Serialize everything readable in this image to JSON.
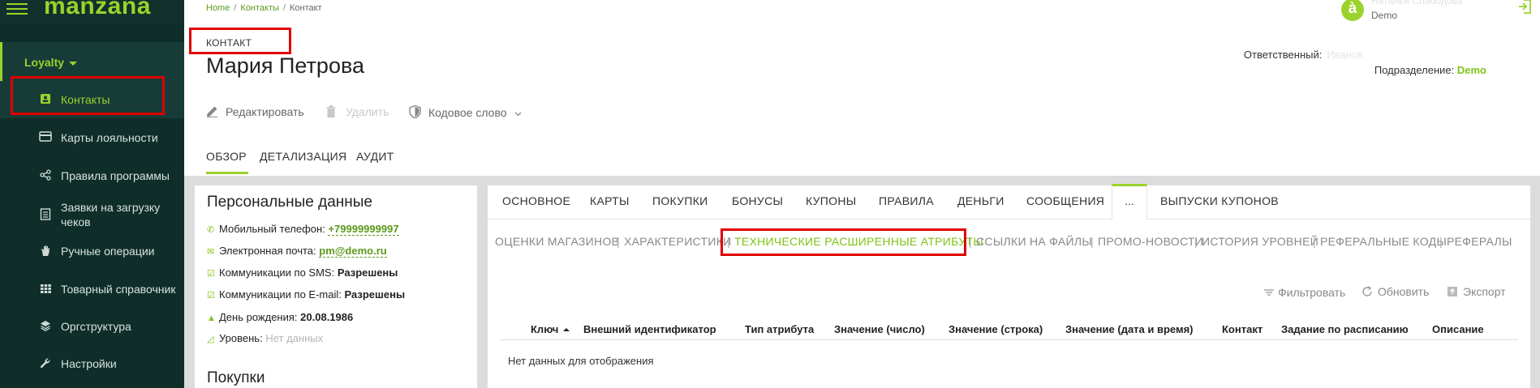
{
  "app": {
    "logo": "manzana"
  },
  "sidebar": {
    "group_label": "Loyalty",
    "items": [
      {
        "label": "Контакты",
        "icon": "contact-card-icon",
        "active": true
      },
      {
        "label": "Карты лояльности",
        "icon": "credit-card-icon"
      },
      {
        "label": "Правила программы",
        "icon": "share-nodes-icon"
      },
      {
        "label": "Заявки на загрузку чеков",
        "icon": "document-list-icon"
      },
      {
        "label": "Ручные операции",
        "icon": "hand-icon"
      },
      {
        "label": "Товарный справочник",
        "icon": "grid-icon"
      },
      {
        "label": "Оргструктура",
        "icon": "layers-icon"
      },
      {
        "label": "Настройки",
        "icon": "wrench-icon"
      }
    ]
  },
  "breadcrumb": {
    "home": "Home",
    "contacts": "Контакты",
    "current": "Контакт"
  },
  "user": {
    "avatar_letter": "à",
    "name": "Наталья Слабодова",
    "org": "Demo"
  },
  "page": {
    "kind": "КОНТАКТ",
    "title": "Мария Петрова",
    "responsible_label": "Ответственный:",
    "responsible_value": "Иванов",
    "dept_label": "Подразделение:",
    "dept_value": "Demo"
  },
  "actions": {
    "edit": "Редактировать",
    "delete": "Удалить",
    "codeword": "Кодовое слово"
  },
  "tabs": {
    "overview": "ОБЗОР",
    "details": "ДЕТАЛИЗАЦИЯ",
    "audit": "АУДИТ"
  },
  "personal": {
    "title": "Персональные данные",
    "phone_label": "Мобильный телефон:",
    "phone_value": "+79999999997",
    "email_label": "Электронная почта:",
    "email_value": "pm@demo.ru",
    "sms_label": "Коммуникации по SMS:",
    "sms_value": "Разрешены",
    "mailcomm_label": "Коммуникации по E-mail:",
    "mailcomm_value": "Разрешены",
    "birthday_label": "День рождения:",
    "birthday_value": "20.08.1986",
    "level_label": "Уровень:",
    "level_value": "Нет данных",
    "purchases_title": "Покупки"
  },
  "right_tabs": {
    "main": "ОСНОВНОЕ",
    "cards": "КАРТЫ",
    "purchases": "ПОКУПКИ",
    "bonuses": "БОНУСЫ",
    "coupons": "КУПОНЫ",
    "rules": "ПРАВИЛА",
    "money": "ДЕНЬГИ",
    "messages": "СООБЩЕНИЯ",
    "more": "...",
    "coupon_issues": "ВЫПУСКИ КУПОНОВ"
  },
  "subtabs": {
    "store_ratings": "ОЦЕНКИ МАГАЗИНОВ",
    "characteristics": "ХАРАКТЕРИСТИКИ",
    "tech_attrs": "ТЕХНИЧЕСКИЕ РАСШИРЕННЫЕ АТРИБУТЫ",
    "file_links": "ССЫЛКИ НА ФАЙЛЫ",
    "promo_news": "ПРОМО-НОВОСТИ",
    "level_history": "ИСТОРИЯ УРОВНЕЙ",
    "referral_codes": "РЕФЕРАЛЬНЫЕ КОДЫ",
    "referrals": "РЕФЕРАЛЫ"
  },
  "toolbar": {
    "filter": "Фильтровать",
    "refresh": "Обновить",
    "export": "Экспорт"
  },
  "grid": {
    "columns": [
      "Ключ",
      "Внешний идентификатор",
      "Тип атрибута",
      "Значение (число)",
      "Значение (строка)",
      "Значение (дата и время)",
      "Контакт",
      "Задание по расписанию",
      "Описание"
    ],
    "empty": "Нет данных для отображения"
  },
  "colors": {
    "accent": "#9bd22b",
    "sidebar_bg": "#0f2e2a",
    "highlight": "#e00000"
  }
}
